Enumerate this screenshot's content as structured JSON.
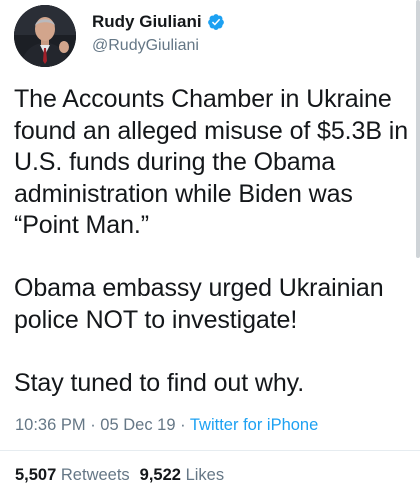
{
  "author": {
    "display_name": "Rudy Giuliani",
    "handle": "@RudyGiuliani",
    "verified": true,
    "avatar_icon": "profile-photo"
  },
  "tweet": {
    "paragraphs": [
      "The Accounts Chamber in Ukraine found an alleged misuse of $5.3B in U.S. funds during the Obama administration while Biden was “Point Man.”",
      "Obama embassy urged Ukrainian police NOT to investigate!",
      "Stay tuned to find out why."
    ]
  },
  "meta": {
    "time": "10:36 PM",
    "separator": " · ",
    "date": "05 Dec 19",
    "source": "Twitter for iPhone"
  },
  "stats": {
    "retweets_count": "5,507",
    "retweets_label": "Retweets",
    "likes_count": "9,522",
    "likes_label": "Likes"
  },
  "colors": {
    "text": "#14171a",
    "secondary": "#657786",
    "accent": "#1da1f2"
  }
}
